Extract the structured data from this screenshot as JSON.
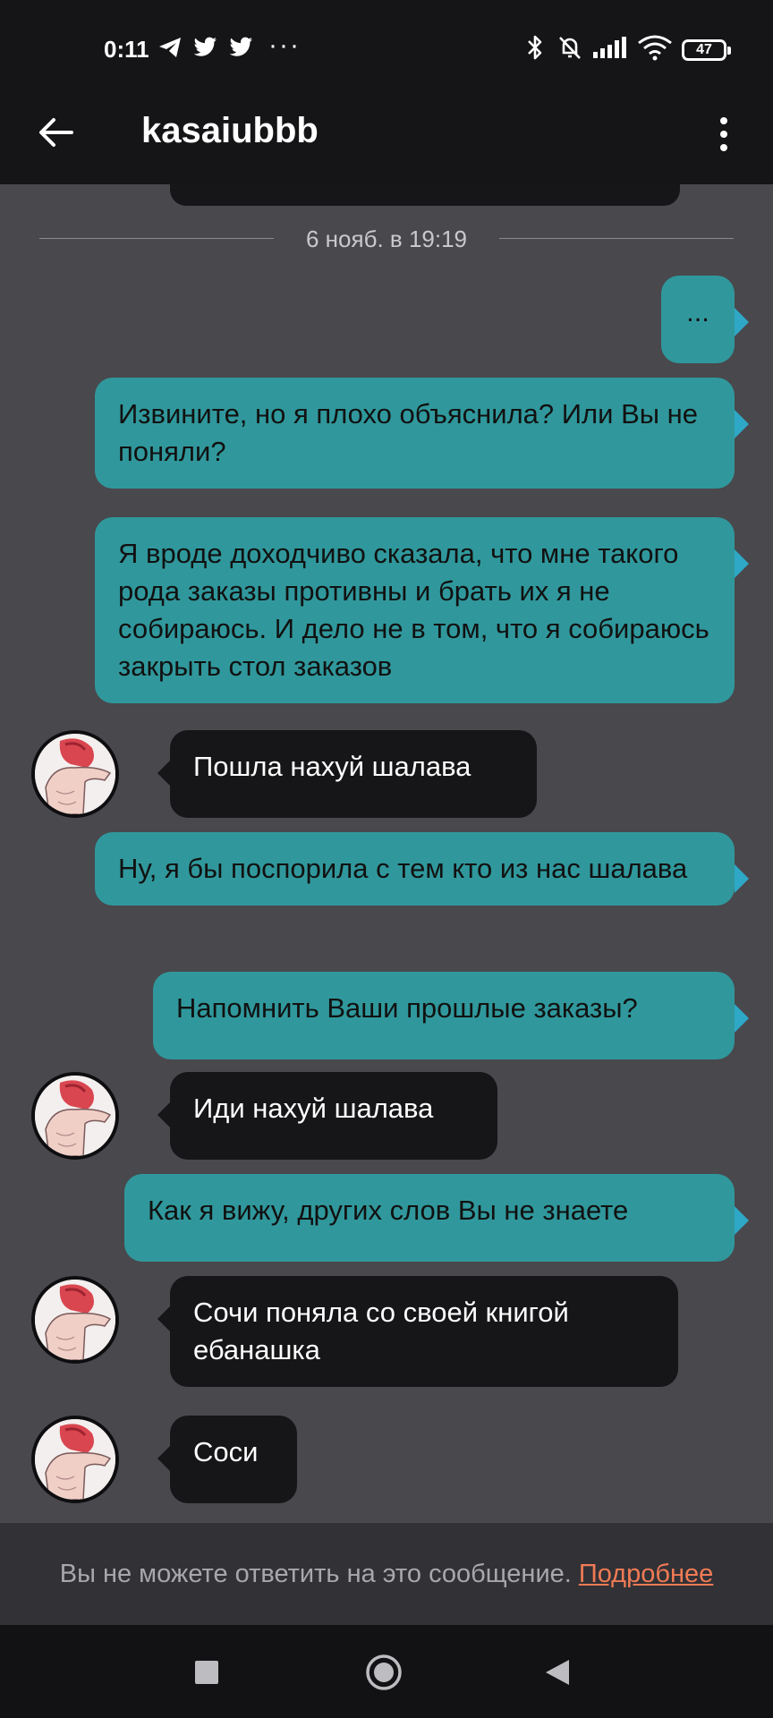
{
  "status_bar": {
    "time": "0:11",
    "battery": "47",
    "more": "···"
  },
  "header": {
    "title": "kasaiubbb"
  },
  "chat": {
    "date_separator": "6 нояб. в 19:19",
    "messages": [
      {
        "side": "out",
        "text": "..."
      },
      {
        "side": "out",
        "text": "Извините, но я плохо объяснила? Или Вы не поняли?"
      },
      {
        "side": "out",
        "text": "Я вроде доходчиво сказала, что мне такого рода заказы противны и брать их я не собираюсь. И дело не в том, что я собираюсь закрыть стол заказов"
      },
      {
        "side": "in",
        "text": "Пошла нахуй шалава"
      },
      {
        "side": "out",
        "text": "Ну, я бы поспорила с тем кто из нас шалава"
      },
      {
        "side": "out",
        "text": "Напомнить Ваши прошлые заказы?"
      },
      {
        "side": "in",
        "text": "Иди нахуй шалава"
      },
      {
        "side": "out",
        "text": "Как я вижу, других слов Вы не знаете"
      },
      {
        "side": "in",
        "text": "Сочи поняла со своей книгой ебанашка"
      },
      {
        "side": "in",
        "text": "Соси"
      }
    ]
  },
  "footer": {
    "notice": "Вы не можете ответить на это сообщение.",
    "link": "Подробнее"
  },
  "colors": {
    "background": "#49484d",
    "outgoing_bubble": "#30989c",
    "incoming_bubble": "#161517",
    "link": "#f07b55"
  }
}
